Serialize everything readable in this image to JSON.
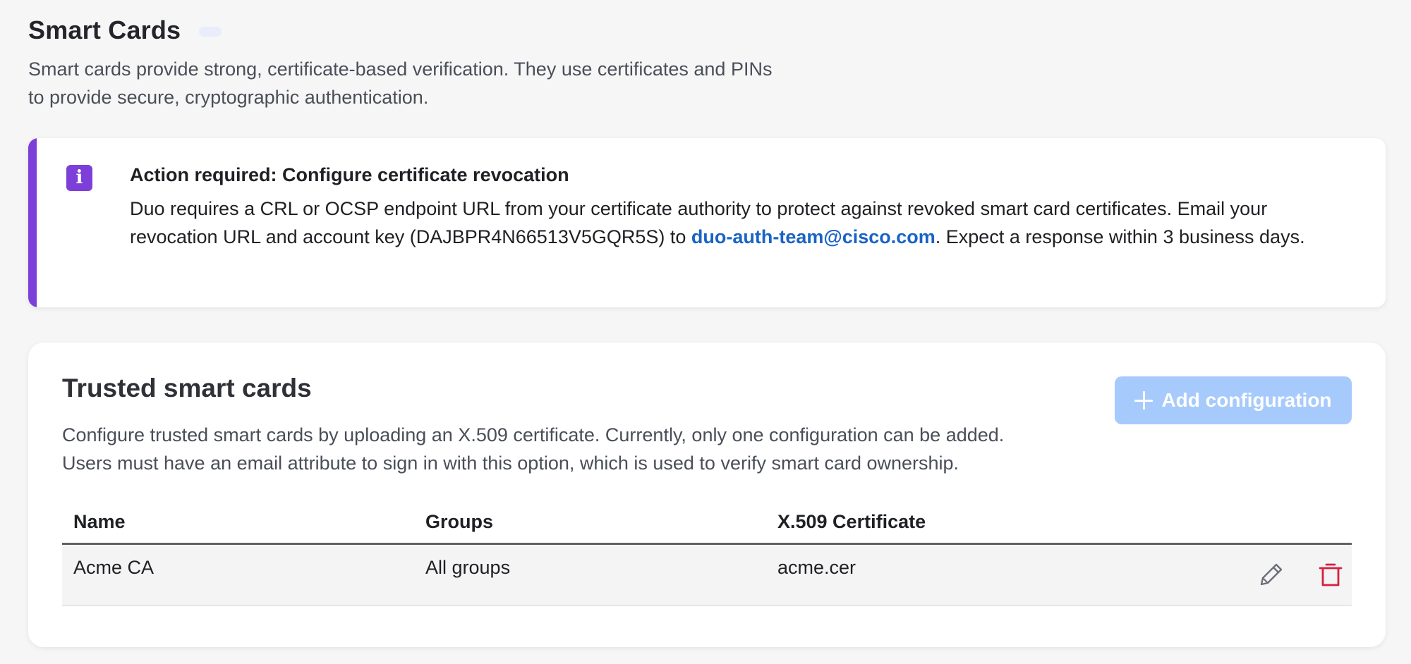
{
  "header": {
    "title": "Smart Cards",
    "description_line1": "Smart cards provide strong, certificate-based verification. They use certificates and PINs",
    "description_line2": "to provide secure, cryptographic authentication."
  },
  "alert": {
    "icon": "info-icon",
    "icon_glyph": "i",
    "accent_color": "#7d3fd9",
    "title": "Action required: Configure certificate revocation",
    "text_before_link": "Duo requires a CRL or OCSP endpoint URL from your certificate authority to protect against revoked smart card certificates. Email your revocation URL and account key (DAJBPR4N66513V5GQR5S) to ",
    "link_text": "duo-auth-team@cisco.com",
    "text_after_link": ". Expect a response within 3 business days."
  },
  "trusted_cards": {
    "title": "Trusted smart cards",
    "add_button_label": "Add configuration",
    "add_button_icon": "plus-icon",
    "add_button_color": "#a6cafb",
    "description_line1": "Configure trusted smart cards by uploading an X.509 certificate. Currently, only one configuration can be added.",
    "description_line2": "Users must have an email attribute to sign in with this option, which is used to verify smart card ownership.",
    "table": {
      "columns": [
        "Name",
        "Groups",
        "X.509 Certificate"
      ],
      "rows": [
        {
          "name": "Acme CA",
          "groups": "All groups",
          "certificate": "acme.cer",
          "actions": [
            "pencil-icon",
            "trash-icon"
          ]
        }
      ]
    },
    "delete_color": "#d4213d"
  }
}
